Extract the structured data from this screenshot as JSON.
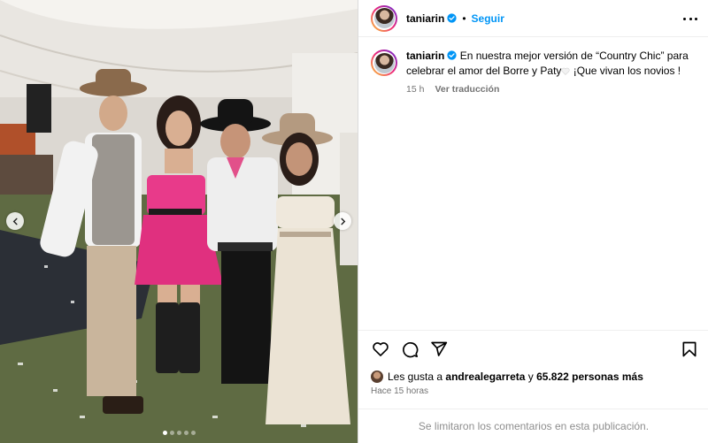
{
  "post": {
    "username": "taniarin",
    "follow_label": "Seguir",
    "separator": "•",
    "caption": {
      "text_before_heart": "En nuestra mejor versión de “Country Chic” para celebrar el amor del Borre y Paty",
      "heart_icon": "white-heart-icon",
      "text_after_heart": " ¡Que vivan los novios !",
      "time": "15 h",
      "translate_label": "Ver traducción"
    },
    "likes": {
      "prefix": "Les gusta a",
      "liker": "andrealegarreta",
      "joiner": "y",
      "count_text": "65.822 personas más"
    },
    "time_ago": "Hace 15 horas",
    "comments_disabled": "Se limitaron los comentarios en esta publicación."
  },
  "carousel": {
    "slide_count": 5,
    "active_index": 0
  },
  "icons": {
    "verified": "verified-badge-icon",
    "more": "more-options-icon",
    "like": "heart-icon",
    "comment": "comment-icon",
    "share": "share-icon",
    "save": "bookmark-icon",
    "prev": "chevron-left-icon",
    "next": "chevron-right-icon"
  },
  "colors": {
    "accent": "#0095f6",
    "verified": "#0095f6",
    "muted_text": "#737373"
  }
}
